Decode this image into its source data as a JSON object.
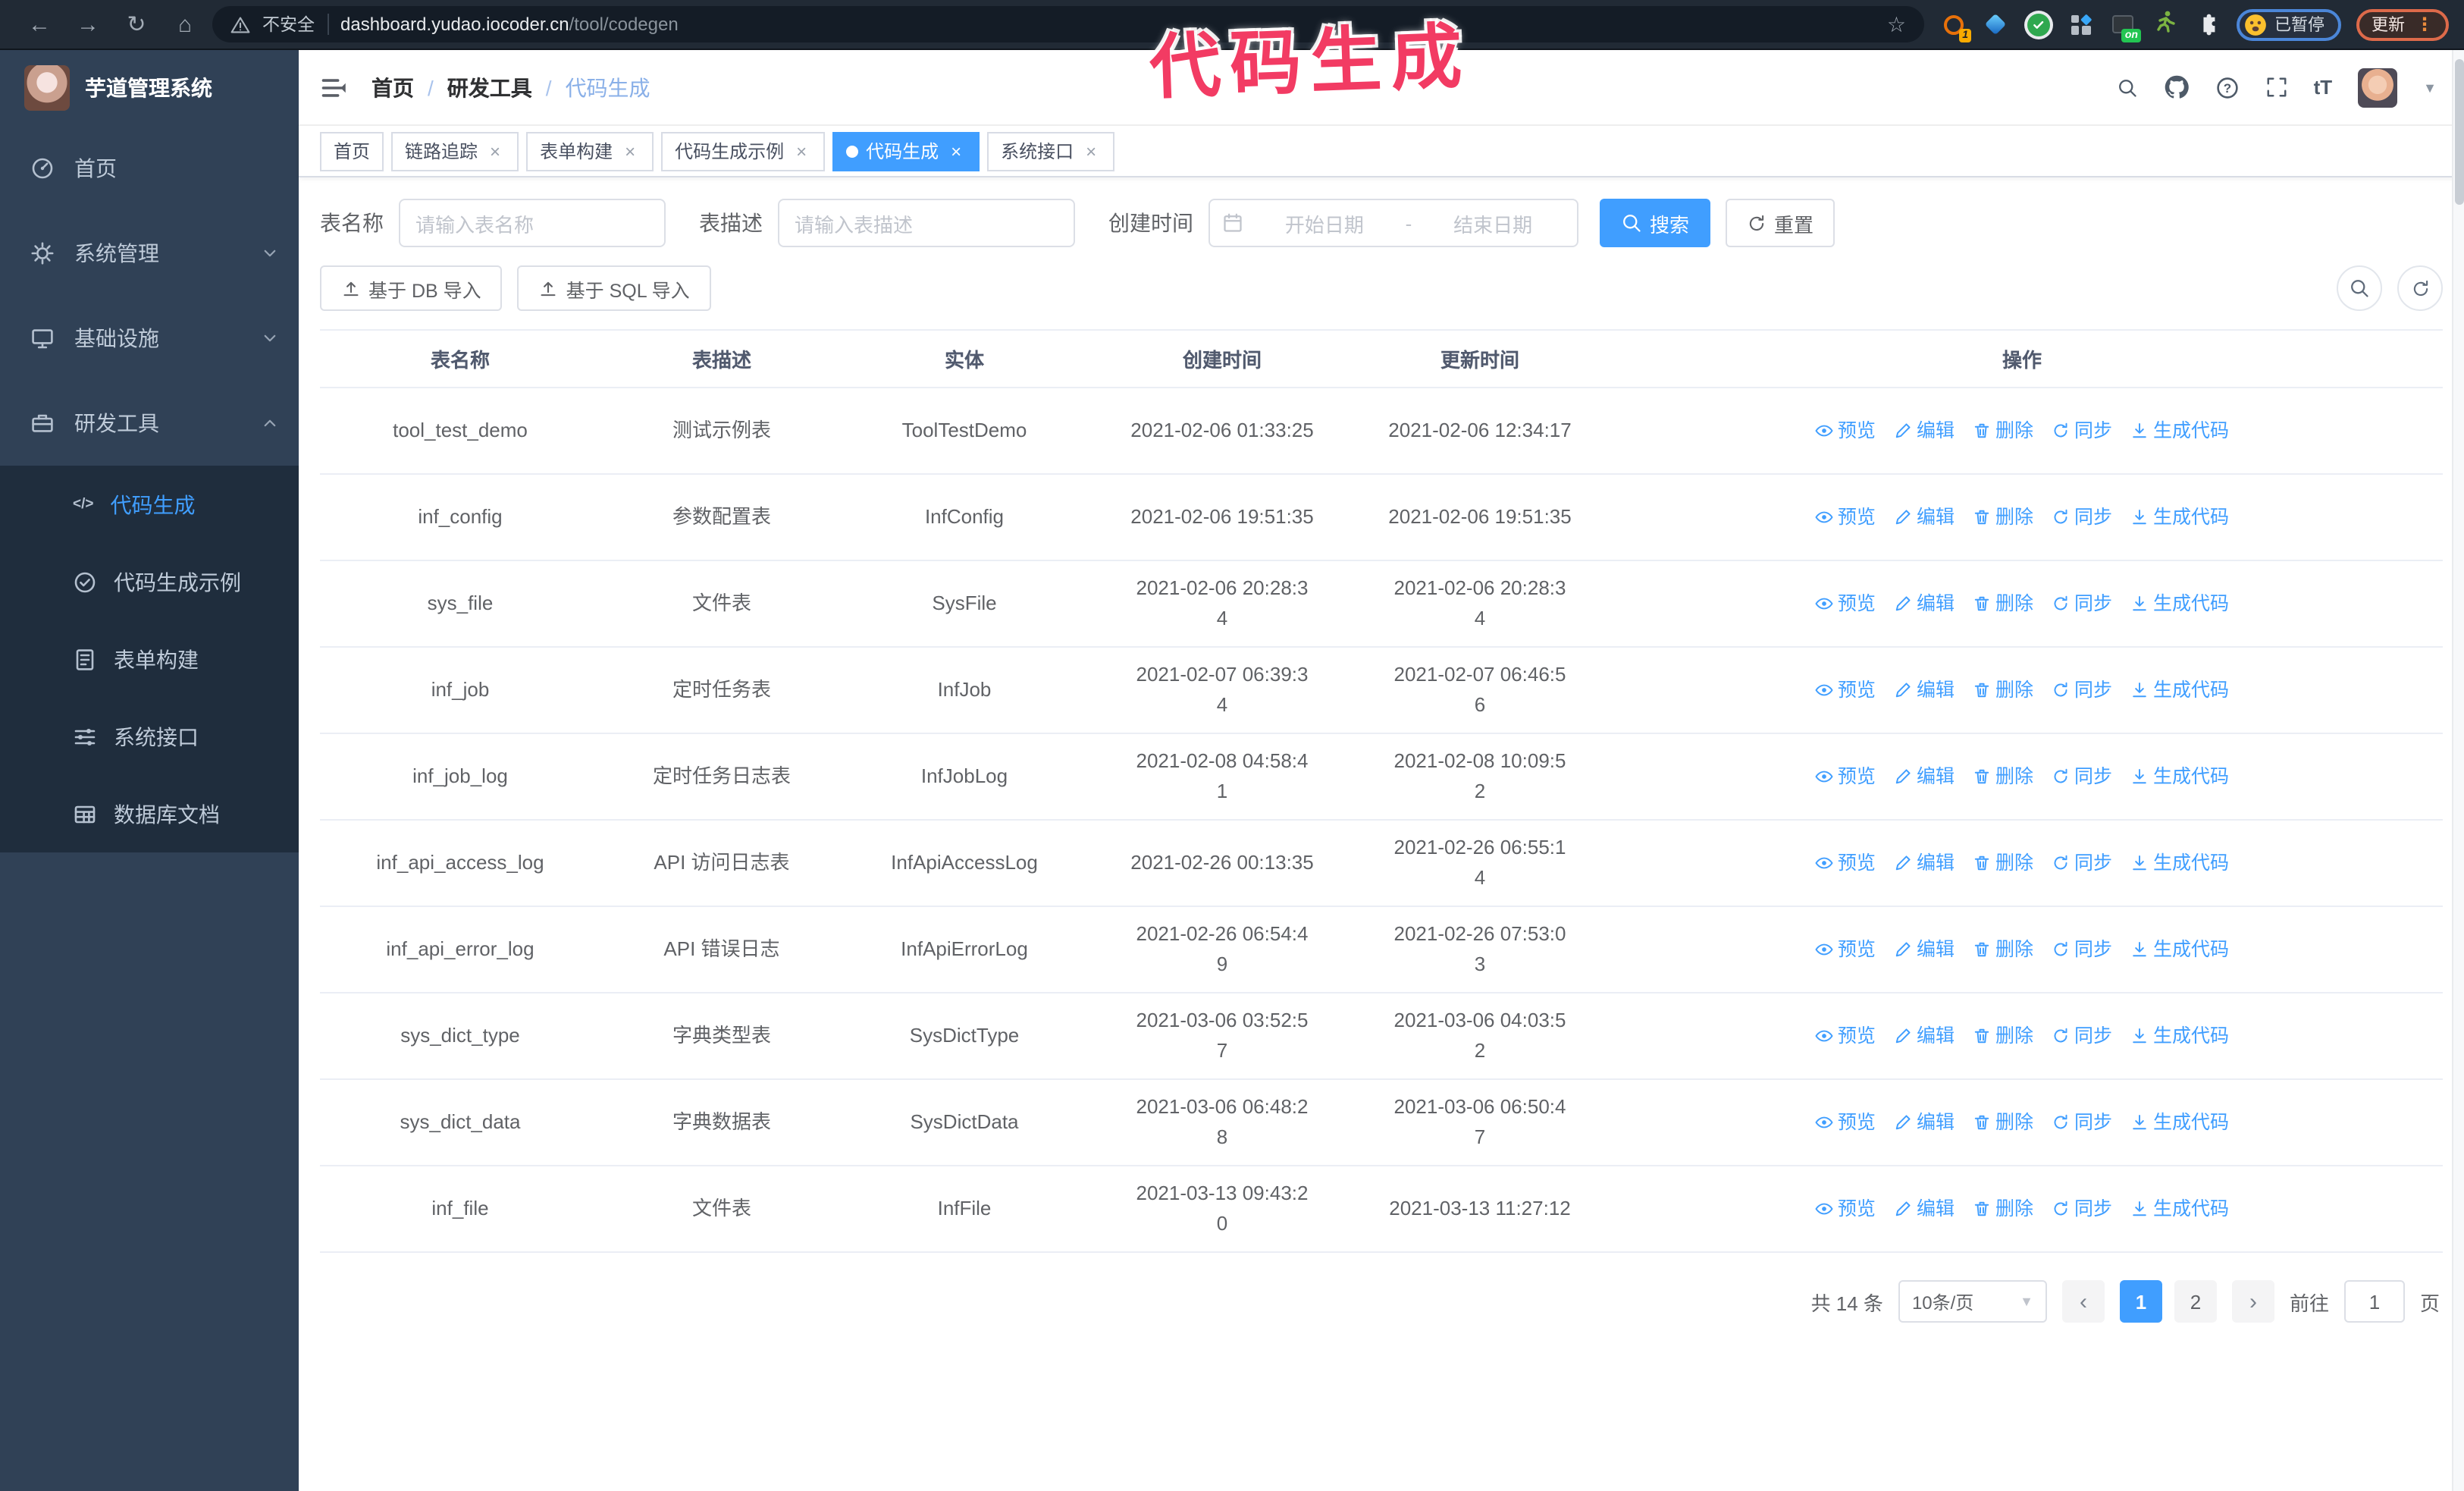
{
  "browser": {
    "security_label": "不安全",
    "url_host": "dashboard.yudao.iocoder.cn",
    "url_path": "/tool/codegen",
    "extensions": [
      {
        "icon": "orange-ring-icon",
        "badge": "1"
      },
      {
        "icon": "blue-diamond-icon"
      },
      {
        "icon": "green-check-icon"
      },
      {
        "icon": "grid-icon"
      },
      {
        "icon": "power-icon",
        "badge": "on"
      },
      {
        "icon": "runner-icon"
      },
      {
        "icon": "puzzle-icon"
      }
    ],
    "paused_chip": "已暂停",
    "update_button": "更新"
  },
  "annotation": {
    "text": "代码生成",
    "color": "#f23b63"
  },
  "sidebar": {
    "logo_title": "芋道管理系统",
    "items": [
      {
        "key": "home",
        "label": "首页",
        "icon": "dashboard-icon"
      },
      {
        "key": "system",
        "label": "系统管理",
        "icon": "gear-icon",
        "chevron": "down"
      },
      {
        "key": "infra",
        "label": "基础设施",
        "icon": "monitor-icon",
        "chevron": "down"
      },
      {
        "key": "devtools",
        "label": "研发工具",
        "icon": "toolbox-icon",
        "chevron": "up",
        "expanded": true,
        "children": [
          {
            "key": "codegen",
            "label": "代码生成",
            "icon": "code-icon",
            "active": true
          },
          {
            "key": "codegen-example",
            "label": "代码生成示例",
            "icon": "check-badge-icon"
          },
          {
            "key": "form-builder",
            "label": "表单构建",
            "icon": "form-icon"
          },
          {
            "key": "system-api",
            "label": "系统接口",
            "icon": "sliders-icon"
          },
          {
            "key": "db-doc",
            "label": "数据库文档",
            "icon": "table-grid-icon"
          }
        ]
      }
    ]
  },
  "navbar": {
    "breadcrumb": [
      "首页",
      "研发工具",
      "代码生成"
    ],
    "right_icons": [
      "search-icon",
      "github-icon",
      "help-icon",
      "fullscreen-icon",
      "font-size-icon"
    ]
  },
  "tabs": [
    {
      "key": "home",
      "label": "首页",
      "closable": false,
      "active": false
    },
    {
      "key": "tracing",
      "label": "链路追踪",
      "closable": true,
      "active": false
    },
    {
      "key": "form-builder",
      "label": "表单构建",
      "closable": true,
      "active": false
    },
    {
      "key": "codegen-example",
      "label": "代码生成示例",
      "closable": true,
      "active": false
    },
    {
      "key": "codegen",
      "label": "代码生成",
      "closable": true,
      "active": true
    },
    {
      "key": "system-api",
      "label": "系统接口",
      "closable": true,
      "active": false
    }
  ],
  "search_form": {
    "name_label": "表名称",
    "name_placeholder": "请输入表名称",
    "desc_label": "表描述",
    "desc_placeholder": "请输入表描述",
    "time_label": "创建时间",
    "start_placeholder": "开始日期",
    "range_separator": "-",
    "end_placeholder": "结束日期",
    "search_button": "搜索",
    "reset_button": "重置"
  },
  "toolbar": {
    "import_db": "基于 DB 导入",
    "import_sql": "基于 SQL 导入"
  },
  "table": {
    "columns": [
      "表名称",
      "表描述",
      "实体",
      "创建时间",
      "更新时间",
      "操作"
    ],
    "actions": [
      {
        "label": "预览",
        "icon": "eye-icon"
      },
      {
        "label": "编辑",
        "icon": "edit-icon"
      },
      {
        "label": "删除",
        "icon": "delete-icon"
      },
      {
        "label": "同步",
        "icon": "sync-icon"
      },
      {
        "label": "生成代码",
        "icon": "download-icon"
      }
    ],
    "rows": [
      {
        "name": "tool_test_demo",
        "desc": "测试示例表",
        "entity": "ToolTestDemo",
        "created": "2021-02-06 01:33:25",
        "updated": "2021-02-06 12:34:17"
      },
      {
        "name": "inf_config",
        "desc": "参数配置表",
        "entity": "InfConfig",
        "created": "2021-02-06 19:51:35",
        "updated": "2021-02-06 19:51:35"
      },
      {
        "name": "sys_file",
        "desc": "文件表",
        "entity": "SysFile",
        "created": "2021-02-06 20:28:3\n4",
        "updated": "2021-02-06 20:28:3\n4"
      },
      {
        "name": "inf_job",
        "desc": "定时任务表",
        "entity": "InfJob",
        "created": "2021-02-07 06:39:3\n4",
        "updated": "2021-02-07 06:46:5\n6"
      },
      {
        "name": "inf_job_log",
        "desc": "定时任务日志表",
        "entity": "InfJobLog",
        "created": "2021-02-08 04:58:4\n1",
        "updated": "2021-02-08 10:09:5\n2"
      },
      {
        "name": "inf_api_access_log",
        "desc": "API 访问日志表",
        "entity": "InfApiAccessLog",
        "created": "2021-02-26 00:13:35",
        "updated": "2021-02-26 06:55:1\n4"
      },
      {
        "name": "inf_api_error_log",
        "desc": "API 错误日志",
        "entity": "InfApiErrorLog",
        "created": "2021-02-26 06:54:4\n9",
        "updated": "2021-02-26 07:53:0\n3"
      },
      {
        "name": "sys_dict_type",
        "desc": "字典类型表",
        "entity": "SysDictType",
        "created": "2021-03-06 03:52:5\n7",
        "updated": "2021-03-06 04:03:5\n2"
      },
      {
        "name": "sys_dict_data",
        "desc": "字典数据表",
        "entity": "SysDictData",
        "created": "2021-03-06 06:48:2\n8",
        "updated": "2021-03-06 06:50:4\n7"
      },
      {
        "name": "inf_file",
        "desc": "文件表",
        "entity": "InfFile",
        "created": "2021-03-13 09:43:2\n0",
        "updated": "2021-03-13 11:27:12"
      }
    ]
  },
  "pagination": {
    "total": "共 14 条",
    "page_size": "10条/页",
    "pages": [
      "1",
      "2"
    ],
    "active_page": "1",
    "goto_label": "前往",
    "goto_value": "1",
    "goto_suffix": "页"
  },
  "colors": {
    "accent": "#409eff",
    "sidebar_bg": "#304156",
    "submenu_bg": "#1f2d3d",
    "annotation": "#f23b63"
  }
}
